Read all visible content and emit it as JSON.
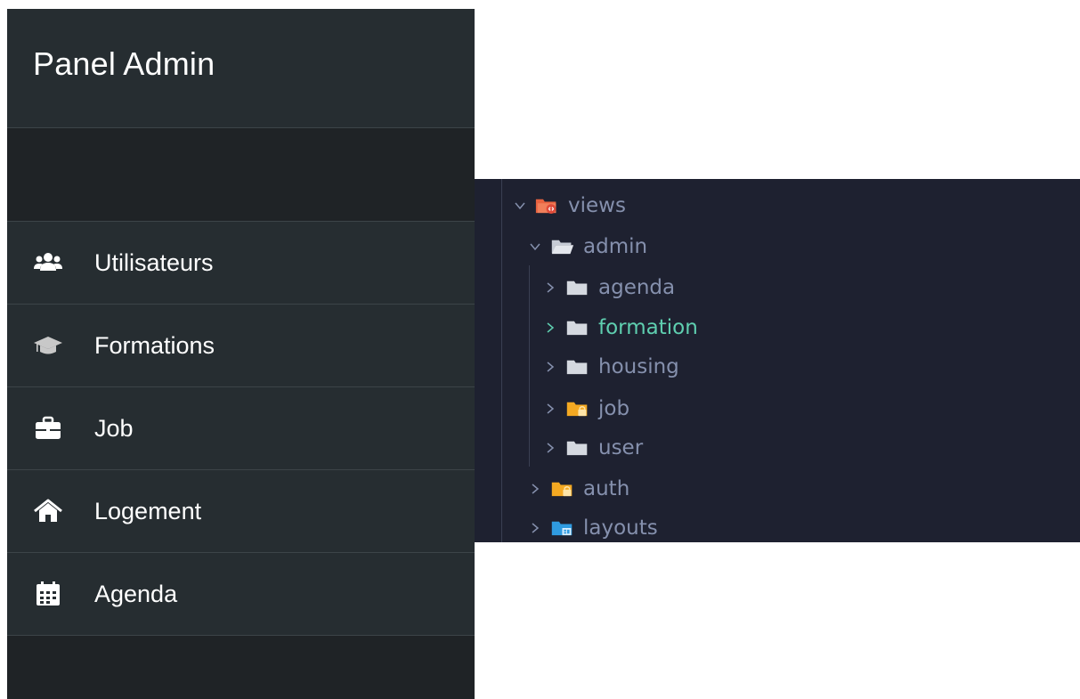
{
  "sidebar": {
    "title": "Panel Admin",
    "items": [
      {
        "label": "Utilisateurs",
        "icon": "users-icon"
      },
      {
        "label": "Formations",
        "icon": "graduation-cap-icon"
      },
      {
        "label": "Job",
        "icon": "briefcase-icon"
      },
      {
        "label": "Logement",
        "icon": "home-icon"
      },
      {
        "label": "Agenda",
        "icon": "calendar-icon"
      }
    ]
  },
  "explorer": {
    "folders": [
      {
        "label": "views",
        "state": "expanded",
        "icon": "views-folder-icon"
      },
      {
        "label": "admin",
        "state": "expanded",
        "icon": "folder-open-icon"
      },
      {
        "label": "agenda",
        "state": "collapsed",
        "icon": "folder-icon"
      },
      {
        "label": "formation",
        "state": "collapsed",
        "icon": "folder-icon",
        "highlight": "#5fcfb0"
      },
      {
        "label": "housing",
        "state": "collapsed",
        "icon": "folder-icon"
      },
      {
        "label": "job",
        "state": "collapsed",
        "icon": "locked-folder-icon"
      },
      {
        "label": "user",
        "state": "collapsed",
        "icon": "folder-icon"
      },
      {
        "label": "auth",
        "state": "collapsed",
        "icon": "locked-folder-icon"
      },
      {
        "label": "layouts",
        "state": "collapsed",
        "icon": "layout-folder-icon"
      }
    ]
  },
  "colors": {
    "sidebar_bg": "#262d31",
    "explorer_bg": "#1e2130",
    "tree_text": "#8590ad",
    "active_text": "#5fcfb0"
  }
}
